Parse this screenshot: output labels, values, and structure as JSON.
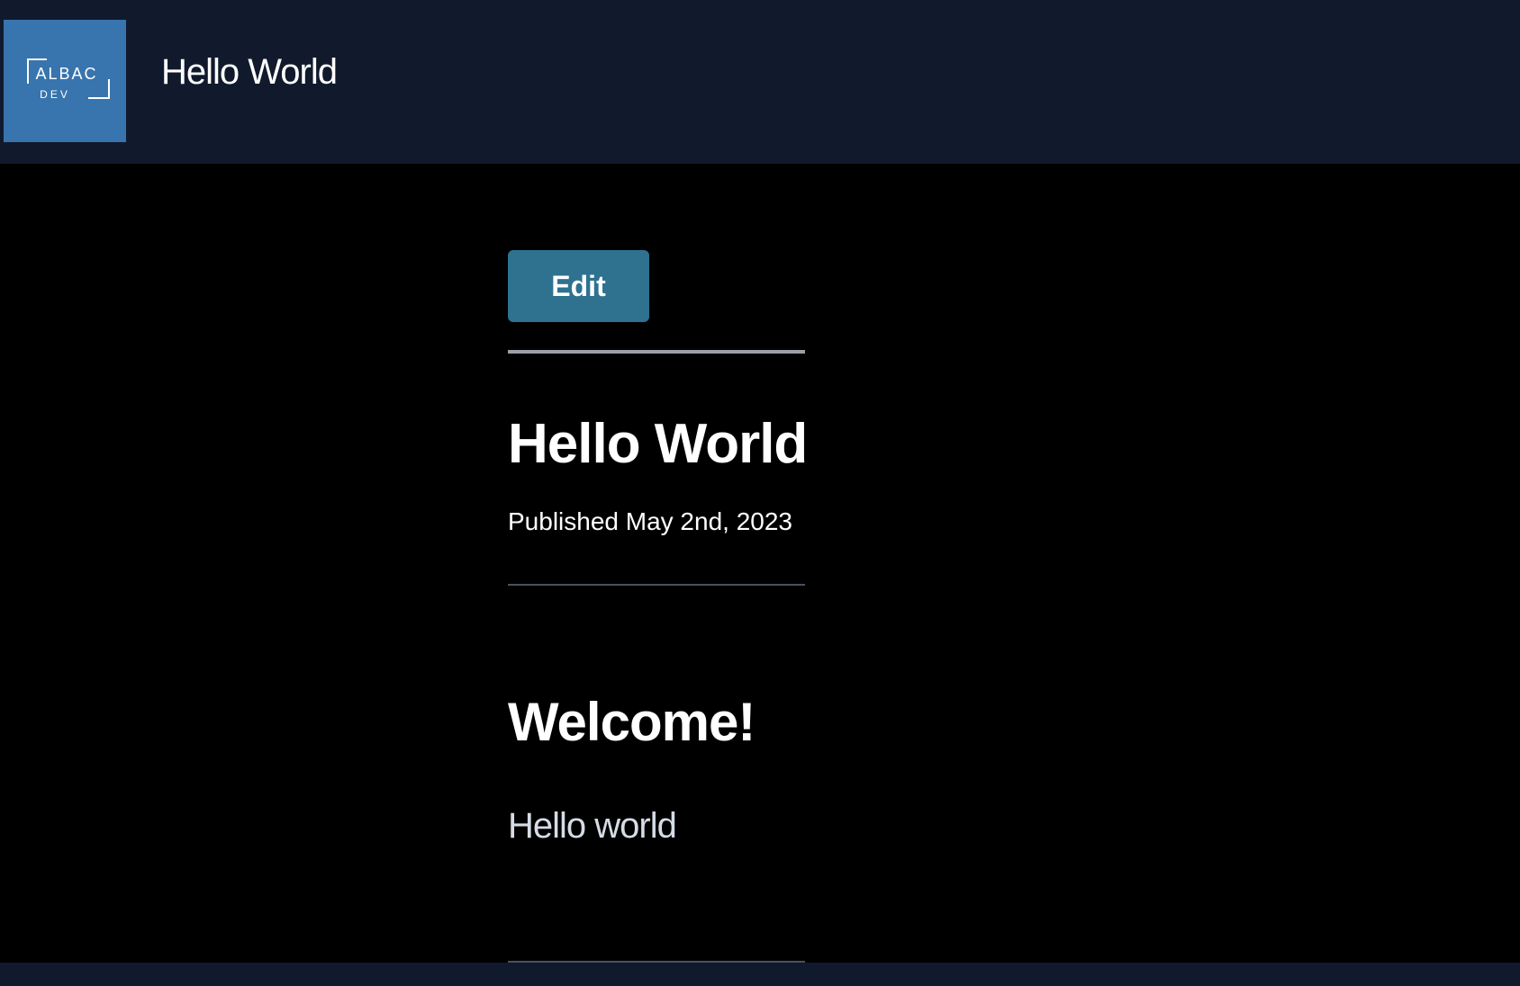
{
  "header": {
    "logo_text": "ALBAC",
    "logo_subtext": "DEV",
    "site_title": "Hello World"
  },
  "post": {
    "edit_label": "Edit",
    "title": "Hello World",
    "published": "Published May 2nd, 2023",
    "content_heading": "Welcome!",
    "content_body": "Hello world"
  },
  "colors": {
    "header_bg": "#111a2c",
    "logo_bg": "#3874ad",
    "edit_button_bg": "#2e7290",
    "page_bg": "#000000"
  }
}
